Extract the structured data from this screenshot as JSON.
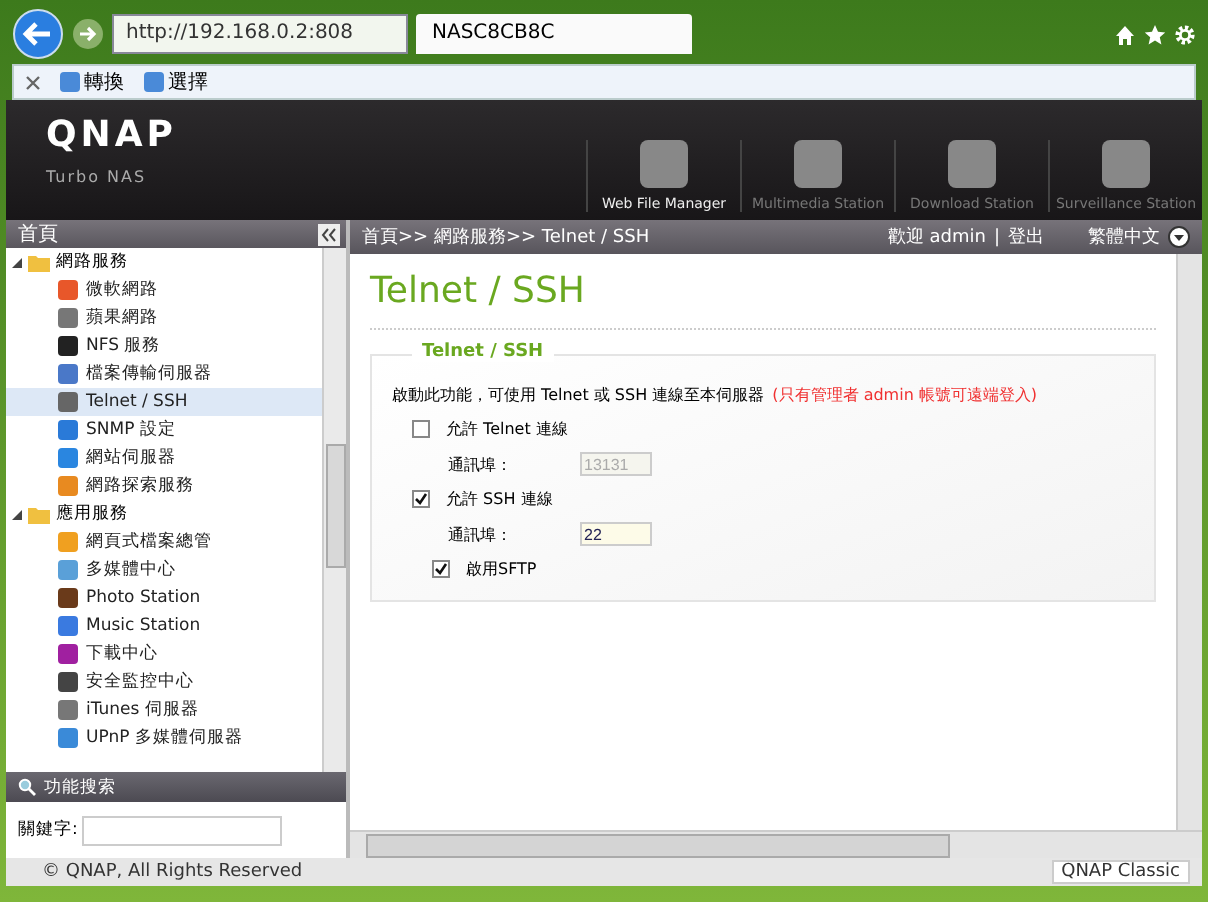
{
  "browser": {
    "address": "http://192.168.0.2:808",
    "tab_title": "NASC8CB8C",
    "toolbar": [
      {
        "label": "轉換"
      },
      {
        "label": "選擇"
      }
    ]
  },
  "header": {
    "logo": "QNAP",
    "subtitle": "Turbo NAS",
    "apps": [
      {
        "label": "Web File Manager",
        "disabled": false
      },
      {
        "label": "Multimedia Station",
        "disabled": true
      },
      {
        "label": "Download Station",
        "disabled": true
      },
      {
        "label": "Surveillance Station",
        "disabled": true
      }
    ]
  },
  "sidebar": {
    "title": "首頁",
    "tree": [
      {
        "label": "網路服務",
        "expanded": true,
        "children": [
          {
            "label": "微軟網路",
            "selected": false
          },
          {
            "label": "蘋果網路",
            "selected": false
          },
          {
            "label": "NFS 服務",
            "selected": false
          },
          {
            "label": "檔案傳輸伺服器",
            "selected": false
          },
          {
            "label": "Telnet / SSH",
            "selected": true
          },
          {
            "label": "SNMP 設定",
            "selected": false
          },
          {
            "label": "網站伺服器",
            "selected": false
          },
          {
            "label": "網路探索服務",
            "selected": false
          }
        ]
      },
      {
        "label": "應用服務",
        "expanded": true,
        "children": [
          {
            "label": "網頁式檔案總管",
            "selected": false
          },
          {
            "label": "多媒體中心",
            "selected": false
          },
          {
            "label": "Photo Station",
            "selected": false
          },
          {
            "label": "Music Station",
            "selected": false
          },
          {
            "label": "下載中心",
            "selected": false
          },
          {
            "label": "安全監控中心",
            "selected": false
          },
          {
            "label": "iTunes 伺服器",
            "selected": false
          },
          {
            "label": "UPnP 多媒體伺服器",
            "selected": false
          }
        ]
      }
    ],
    "search": {
      "title": "功能搜索",
      "label": "關鍵字:"
    }
  },
  "topbar": {
    "breadcrumb": "首頁>> 網路服務>> Telnet / SSH",
    "welcome": "歡迎 admin",
    "separator": "|",
    "logout": "登出",
    "language": "繁體中文"
  },
  "content": {
    "title": "Telnet / SSH",
    "section": "Telnet / SSH",
    "description": "啟動此功能，可使用 Telnet 或 SSH 連線至本伺服器",
    "warning": "(只有管理者 admin 帳號可遠端登入)",
    "options": [
      {
        "label": "允許 Telnet 連線",
        "checked": false,
        "port_label": "通訊埠：",
        "port": "13131",
        "disabled": true
      },
      {
        "label": "允許 SSH 連線",
        "checked": true,
        "port_label": "通訊埠：",
        "port": "22",
        "disabled": false,
        "sub": {
          "label": "啟用SFTP",
          "checked": true
        }
      }
    ]
  },
  "footer": {
    "copyright": "© QNAP, All Rights Reserved",
    "theme": "QNAP Classic"
  }
}
